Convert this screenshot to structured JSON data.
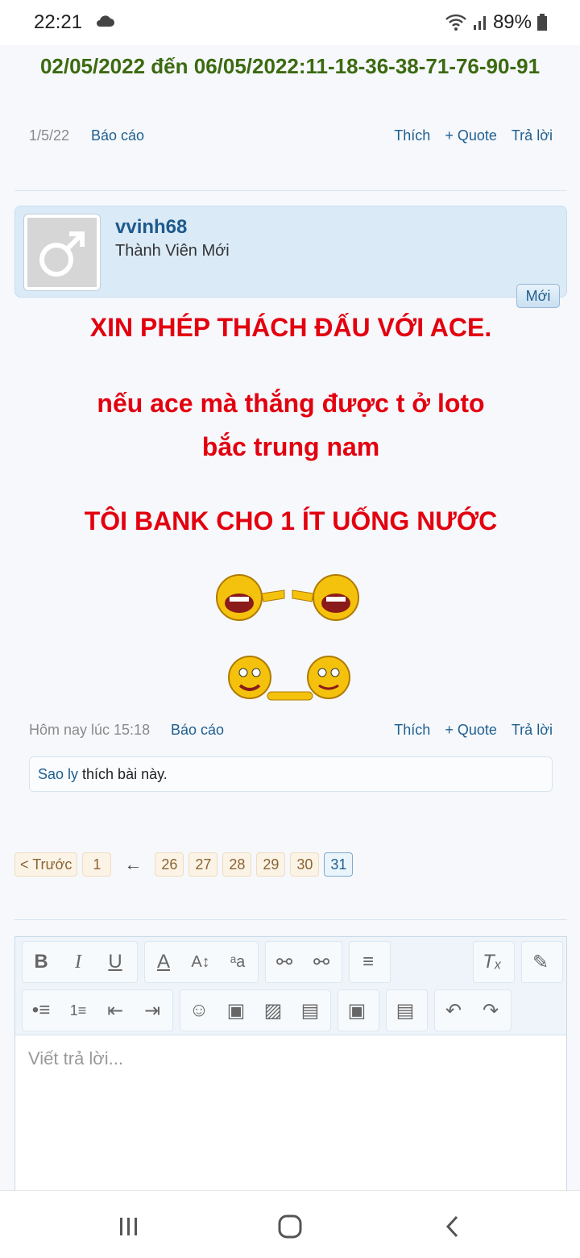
{
  "status": {
    "time": "22:21",
    "battery": "89%"
  },
  "previous_post": {
    "numbers": "02/05/2022 đến 06/05/2022:11-18-36-38-71-76-90-91",
    "date": "1/5/22",
    "report": "Báo cáo",
    "like": "Thích",
    "quote": "+ Quote",
    "reply": "Trả lời"
  },
  "post": {
    "username": "vvinh68",
    "user_title": "Thành Viên Mới",
    "badge": "Mới",
    "lines": [
      "XIN PHÉP THÁCH ĐẤU VỚI ACE.",
      "nếu ace mà thắng được t ở loto",
      "bắc trung nam",
      "TÔI BANK CHO 1 ÍT UỐNG NƯỚC"
    ],
    "date": "Hôm nay lúc 15:18",
    "report": "Báo cáo",
    "like": "Thích",
    "quote": "+ Quote",
    "reply": "Trả lời",
    "liker": "Sao ly",
    "likes_text": " thích bài này."
  },
  "pagination": {
    "prev": "< Trước",
    "first": "1",
    "arrow": "←",
    "pages": [
      "26",
      "27",
      "28",
      "29",
      "30",
      "31"
    ],
    "current": "31"
  },
  "editor": {
    "placeholder": "Viết trả lời..."
  },
  "icons": [
    "cloud-icon",
    "wifi-icon",
    "signal-icon",
    "battery-icon",
    "recents-icon",
    "home-icon",
    "back-icon"
  ]
}
